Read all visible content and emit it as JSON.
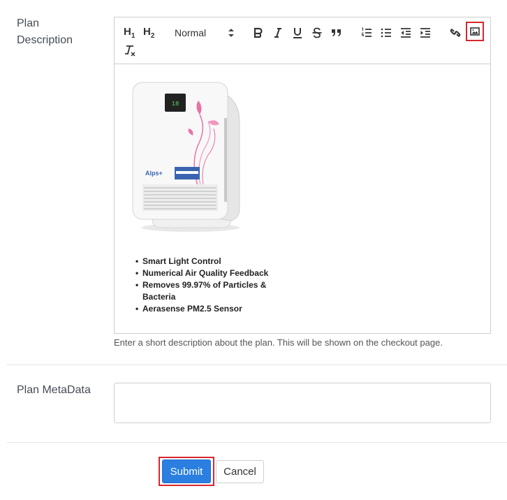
{
  "form": {
    "description_label": "Plan Description",
    "description_help": "Enter a short description about the plan. This will be shown on the checkout page.",
    "metadata_label": "Plan MetaData",
    "metadata_value": ""
  },
  "toolbar": {
    "h1": "H",
    "h1_sub": "1",
    "h2": "H",
    "h2_sub": "2",
    "header_select": "Normal",
    "icons": [
      "header-1-icon",
      "header-2-icon",
      "bold-icon",
      "italic-icon",
      "underline-icon",
      "strike-icon",
      "blockquote-icon",
      "ordered-list-icon",
      "bullet-list-icon",
      "outdent-icon",
      "indent-icon",
      "link-icon",
      "image-icon",
      "clean-format-icon"
    ],
    "highlight_color": "#d9262e"
  },
  "editor_content": {
    "product_image": "air-purifier-image",
    "bullets": [
      "Smart Light Control",
      "Numerical Air Quality Feedback",
      "Removes 99.97% of Particles & Bacteria",
      "Aerasense PM2.5 Sensor"
    ]
  },
  "actions": {
    "submit_label": "Submit",
    "cancel_label": "Cancel",
    "submit_color": "#2a7fe0"
  }
}
